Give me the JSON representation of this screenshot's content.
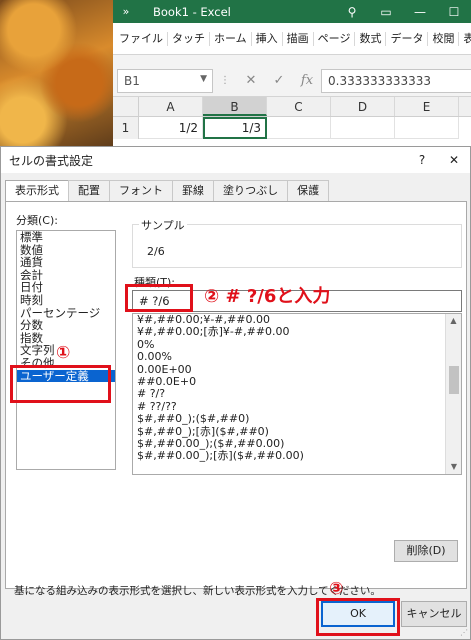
{
  "excel": {
    "title": "Book1 - Excel",
    "ribbon_tabs": [
      "ファイル",
      "タッチ",
      "ホーム",
      "挿入",
      "描画",
      "ページ",
      "数式",
      "データ",
      "校閲",
      "表示"
    ],
    "name_box": "B1",
    "formula_value": "0.333333333333",
    "columns": [
      "A",
      "B",
      "C",
      "D",
      "E"
    ],
    "row_number": "1",
    "cell_a1": "1/2",
    "cell_b1": "1/3"
  },
  "dialog": {
    "title": "セルの書式設定",
    "help": "?",
    "close": "✕",
    "tabs": [
      "表示形式",
      "配置",
      "フォント",
      "罫線",
      "塗りつぶし",
      "保護"
    ],
    "category_label": "分類(C):",
    "categories": [
      "標準",
      "数値",
      "通貨",
      "会計",
      "日付",
      "時刻",
      "パーセンテージ",
      "分数",
      "指数",
      "文字列",
      "その他",
      "ユーザー定義"
    ],
    "selected_category": "ユーザー定義",
    "sample_label": "サンプル",
    "sample_value": "2/6",
    "type_label": "種類(T):",
    "type_value": "# ?/6",
    "format_list": [
      "¥#,##0.00;¥-#,##0.00",
      "¥#,##0.00;[赤]¥-#,##0.00",
      "0%",
      "0.00%",
      "0.00E+00",
      "##0.0E+0",
      "# ?/?",
      "# ??/??",
      "$#,##0_);($#,##0)",
      "$#,##0_);[赤]($#,##0)",
      "$#,##0.00_);($#,##0.00)",
      "$#,##0.00_);[赤]($#,##0.00)"
    ],
    "delete_button": "削除(D)",
    "description": "基になる組み込みの表示形式を選択し、新しい表示形式を入力してください。",
    "ok_button": "OK",
    "cancel_button": "キャンセル"
  },
  "annotations": {
    "step1": "①",
    "step2": "② # ?/6と入力",
    "step3": "③",
    "color": "#e0101a"
  }
}
